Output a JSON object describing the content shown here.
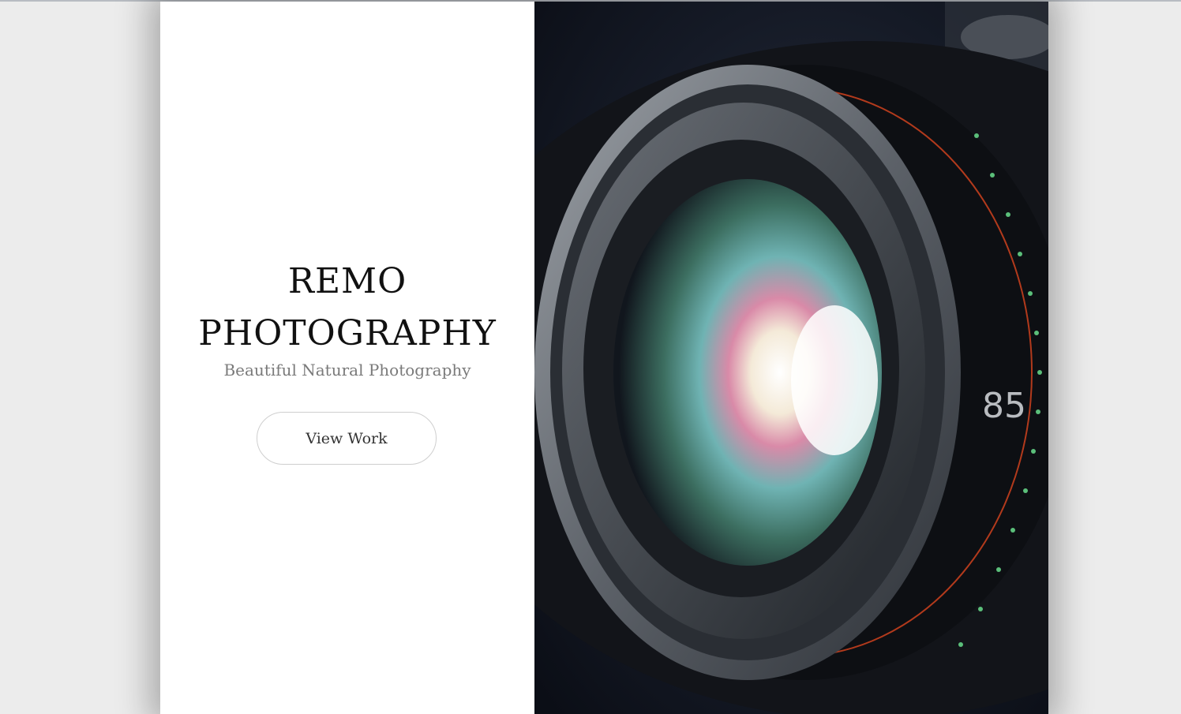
{
  "hero": {
    "title_line1": "REMO",
    "title_line2": "PHOTOGRAPHY",
    "tagline": "Beautiful Natural Photography",
    "cta_label": "View Work"
  },
  "photo": {
    "subject": "camera-lens-photo",
    "lens_marking": "85"
  },
  "colors": {
    "page_background": "#ececec",
    "panel_background": "#ffffff",
    "title_text": "#111111",
    "tagline_text": "#7a7a7a",
    "button_border": "#cfcfcf",
    "photo_dark": "#101522"
  }
}
